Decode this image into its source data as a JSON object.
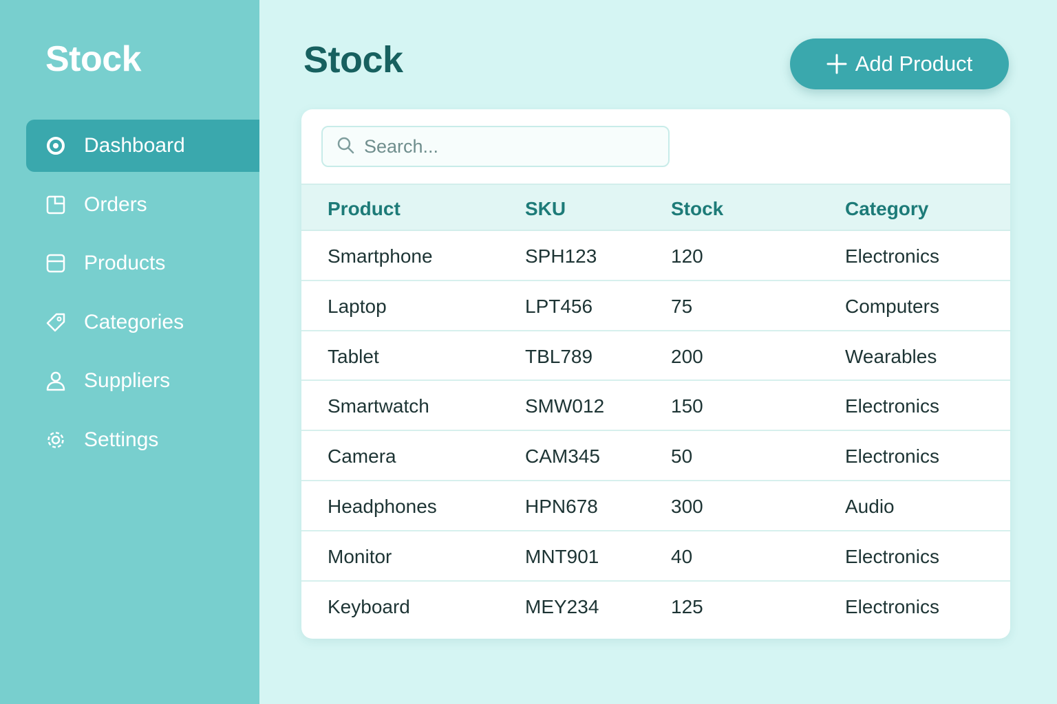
{
  "sidebar": {
    "brand": "Stock",
    "items": [
      {
        "label": "Dashboard",
        "icon": "dashboard-icon",
        "active": true
      },
      {
        "label": "Orders",
        "icon": "orders-icon",
        "active": false
      },
      {
        "label": "Products",
        "icon": "products-icon",
        "active": false
      },
      {
        "label": "Categories",
        "icon": "tag-icon",
        "active": false
      },
      {
        "label": "Suppliers",
        "icon": "user-icon",
        "active": false
      },
      {
        "label": "Settings",
        "icon": "gear-icon",
        "active": false
      }
    ]
  },
  "header": {
    "title": "Stock",
    "add_button_label": "Add Product"
  },
  "search": {
    "placeholder": "Search...",
    "value": ""
  },
  "table": {
    "columns": [
      "Product",
      "SKU",
      "Stock",
      "Category"
    ],
    "rows": [
      {
        "product": "Smartphone",
        "sku": "SPH123",
        "stock": "120",
        "category": "Electronics"
      },
      {
        "product": "Laptop",
        "sku": "LPT456",
        "stock": "75",
        "category": "Computers"
      },
      {
        "product": "Tablet",
        "sku": "TBL789",
        "stock": "200",
        "category": "Wearables"
      },
      {
        "product": "Smartwatch",
        "sku": "SMW012",
        "stock": "150",
        "category": "Electronics"
      },
      {
        "product": "Camera",
        "sku": "CAM345",
        "stock": "50",
        "category": "Electronics"
      },
      {
        "product": "Headphones",
        "sku": "HPN678",
        "stock": "300",
        "category": "Audio"
      },
      {
        "product": "Monitor",
        "sku": "MNT901",
        "stock": "40",
        "category": "Electronics"
      },
      {
        "product": "Keyboard",
        "sku": "MEY234",
        "stock": "125",
        "category": "Electronics"
      }
    ]
  },
  "colors": {
    "sidebar": "#78cfce",
    "accent": "#3aa8ad",
    "background": "#d5f5f3",
    "title": "#17605f",
    "header_text": "#1d7b78"
  }
}
